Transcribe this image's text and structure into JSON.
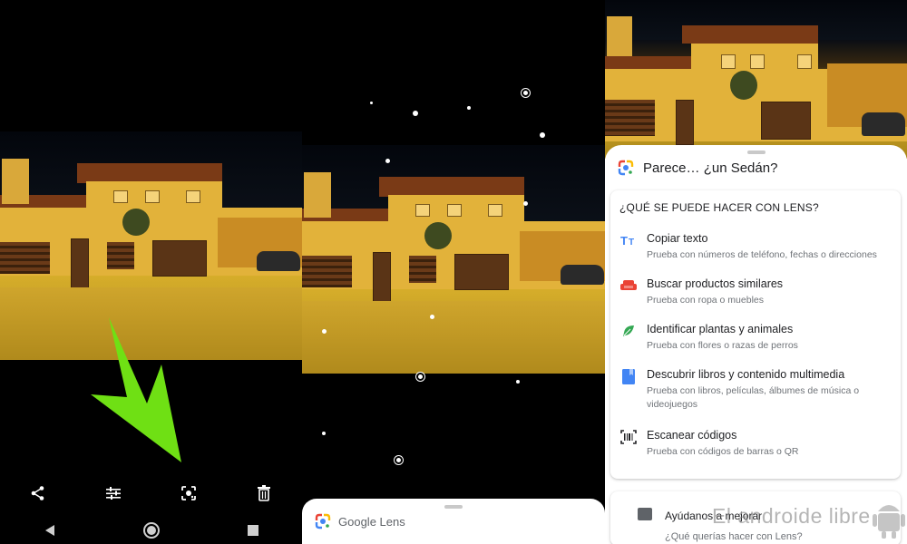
{
  "panel1": {
    "toolbar": [
      {
        "name": "share-icon"
      },
      {
        "name": "edit-sliders-icon"
      },
      {
        "name": "google-lens-icon"
      },
      {
        "name": "trash-icon"
      }
    ],
    "nav": [
      "back-icon",
      "home-icon",
      "recents-icon"
    ],
    "arrow_color": "#6fe014"
  },
  "panel2": {
    "lens_title": "Google Lens"
  },
  "panel3": {
    "header": "Parece… ¿un Sedán?",
    "card_title": "¿QUÉ SE PUEDE HACER CON LENS?",
    "items": [
      {
        "title": "Copiar texto",
        "sub": "Prueba con números de teléfono, fechas o direcciones",
        "icon": "text-icon",
        "color": "#4285f4"
      },
      {
        "title": "Buscar productos similares",
        "sub": "Prueba con ropa o muebles",
        "icon": "sofa-icon",
        "color": "#ea4335"
      },
      {
        "title": "Identificar plantas y animales",
        "sub": "Prueba con flores o razas de perros",
        "icon": "leaf-icon",
        "color": "#34a853"
      },
      {
        "title": "Descubrir libros y contenido multimedia",
        "sub": "Prueba con libros, películas, álbumes de música o videojuegos",
        "icon": "book-icon",
        "color": "#4285f4"
      },
      {
        "title": "Escanear códigos",
        "sub": "Prueba con códigos de barras o QR",
        "icon": "barcode-icon",
        "color": "#202124"
      }
    ],
    "feedback_title": "Ayúdanos a mejorar",
    "feedback_sub": "¿Qué querías hacer con Lens?"
  },
  "watermark": "El androide libre",
  "colors": {
    "lens_blue": "#4285f4",
    "lens_red": "#ea4335",
    "lens_yellow": "#fbbc05",
    "lens_green": "#34a853"
  }
}
